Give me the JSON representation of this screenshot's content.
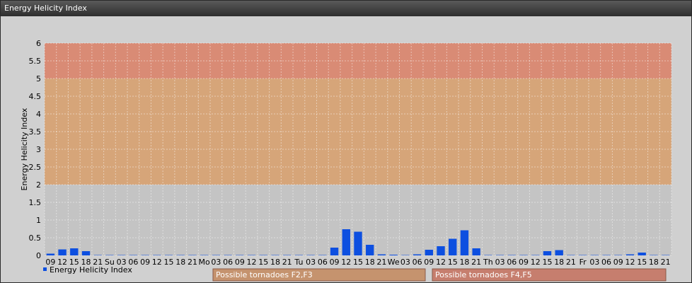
{
  "window": {
    "title": "Energy Helicity Index"
  },
  "chart_data": {
    "type": "bar",
    "ylabel": "Energy Helicity Index",
    "ylim": [
      0,
      6
    ],
    "yticks": [
      "0",
      "0.5",
      "1",
      "1.5",
      "2",
      "2.5",
      "3",
      "3.5",
      "4",
      "4.5",
      "5",
      "5.5",
      "6"
    ],
    "categories": [
      "09",
      "12",
      "15",
      "18",
      "21",
      "Su",
      "03",
      "06",
      "09",
      "12",
      "15",
      "18",
      "21",
      "Mo",
      "03",
      "06",
      "09",
      "12",
      "15",
      "18",
      "21",
      "Tu",
      "03",
      "06",
      "09",
      "12",
      "15",
      "18",
      "21",
      "We",
      "03",
      "06",
      "09",
      "12",
      "15",
      "18",
      "21",
      "Th",
      "03",
      "06",
      "09",
      "12",
      "15",
      "18",
      "21",
      "Fr",
      "03",
      "06",
      "09",
      "12",
      "15",
      "18",
      "21"
    ],
    "series": [
      {
        "name": "Energy Helicity Index",
        "color": "#0d4fe0",
        "values": [
          0.05,
          0.17,
          0.2,
          0.12,
          0.01,
          0.01,
          0.01,
          0.01,
          0.01,
          0.01,
          0.01,
          0.01,
          0.01,
          0.01,
          0.01,
          0.01,
          0.01,
          0.01,
          0.01,
          0.01,
          0.01,
          0.01,
          0.01,
          0.01,
          0.22,
          0.74,
          0.67,
          0.3,
          0.03,
          0.02,
          0.01,
          0.03,
          0.16,
          0.26,
          0.47,
          0.71,
          0.2,
          0.01,
          0.01,
          0.01,
          0.01,
          0.01,
          0.12,
          0.15,
          0.01,
          0.01,
          0.01,
          0.01,
          0.01,
          0.03,
          0.08,
          0.01,
          0.01
        ]
      }
    ],
    "bands": [
      {
        "from": 0,
        "to": 2,
        "color": "#c4c4c4"
      },
      {
        "from": 2,
        "to": 5,
        "color": "#d6a579"
      },
      {
        "from": 5,
        "to": 6,
        "color": "#d98b75"
      }
    ],
    "annotations": [
      {
        "label": "Possible tornadoes F2,F3",
        "color": "#c5936e"
      },
      {
        "label": "Possible tornadoes F4,F5",
        "color": "#c67e6e"
      }
    ],
    "grid": true,
    "legend_position": "bottom-left"
  }
}
